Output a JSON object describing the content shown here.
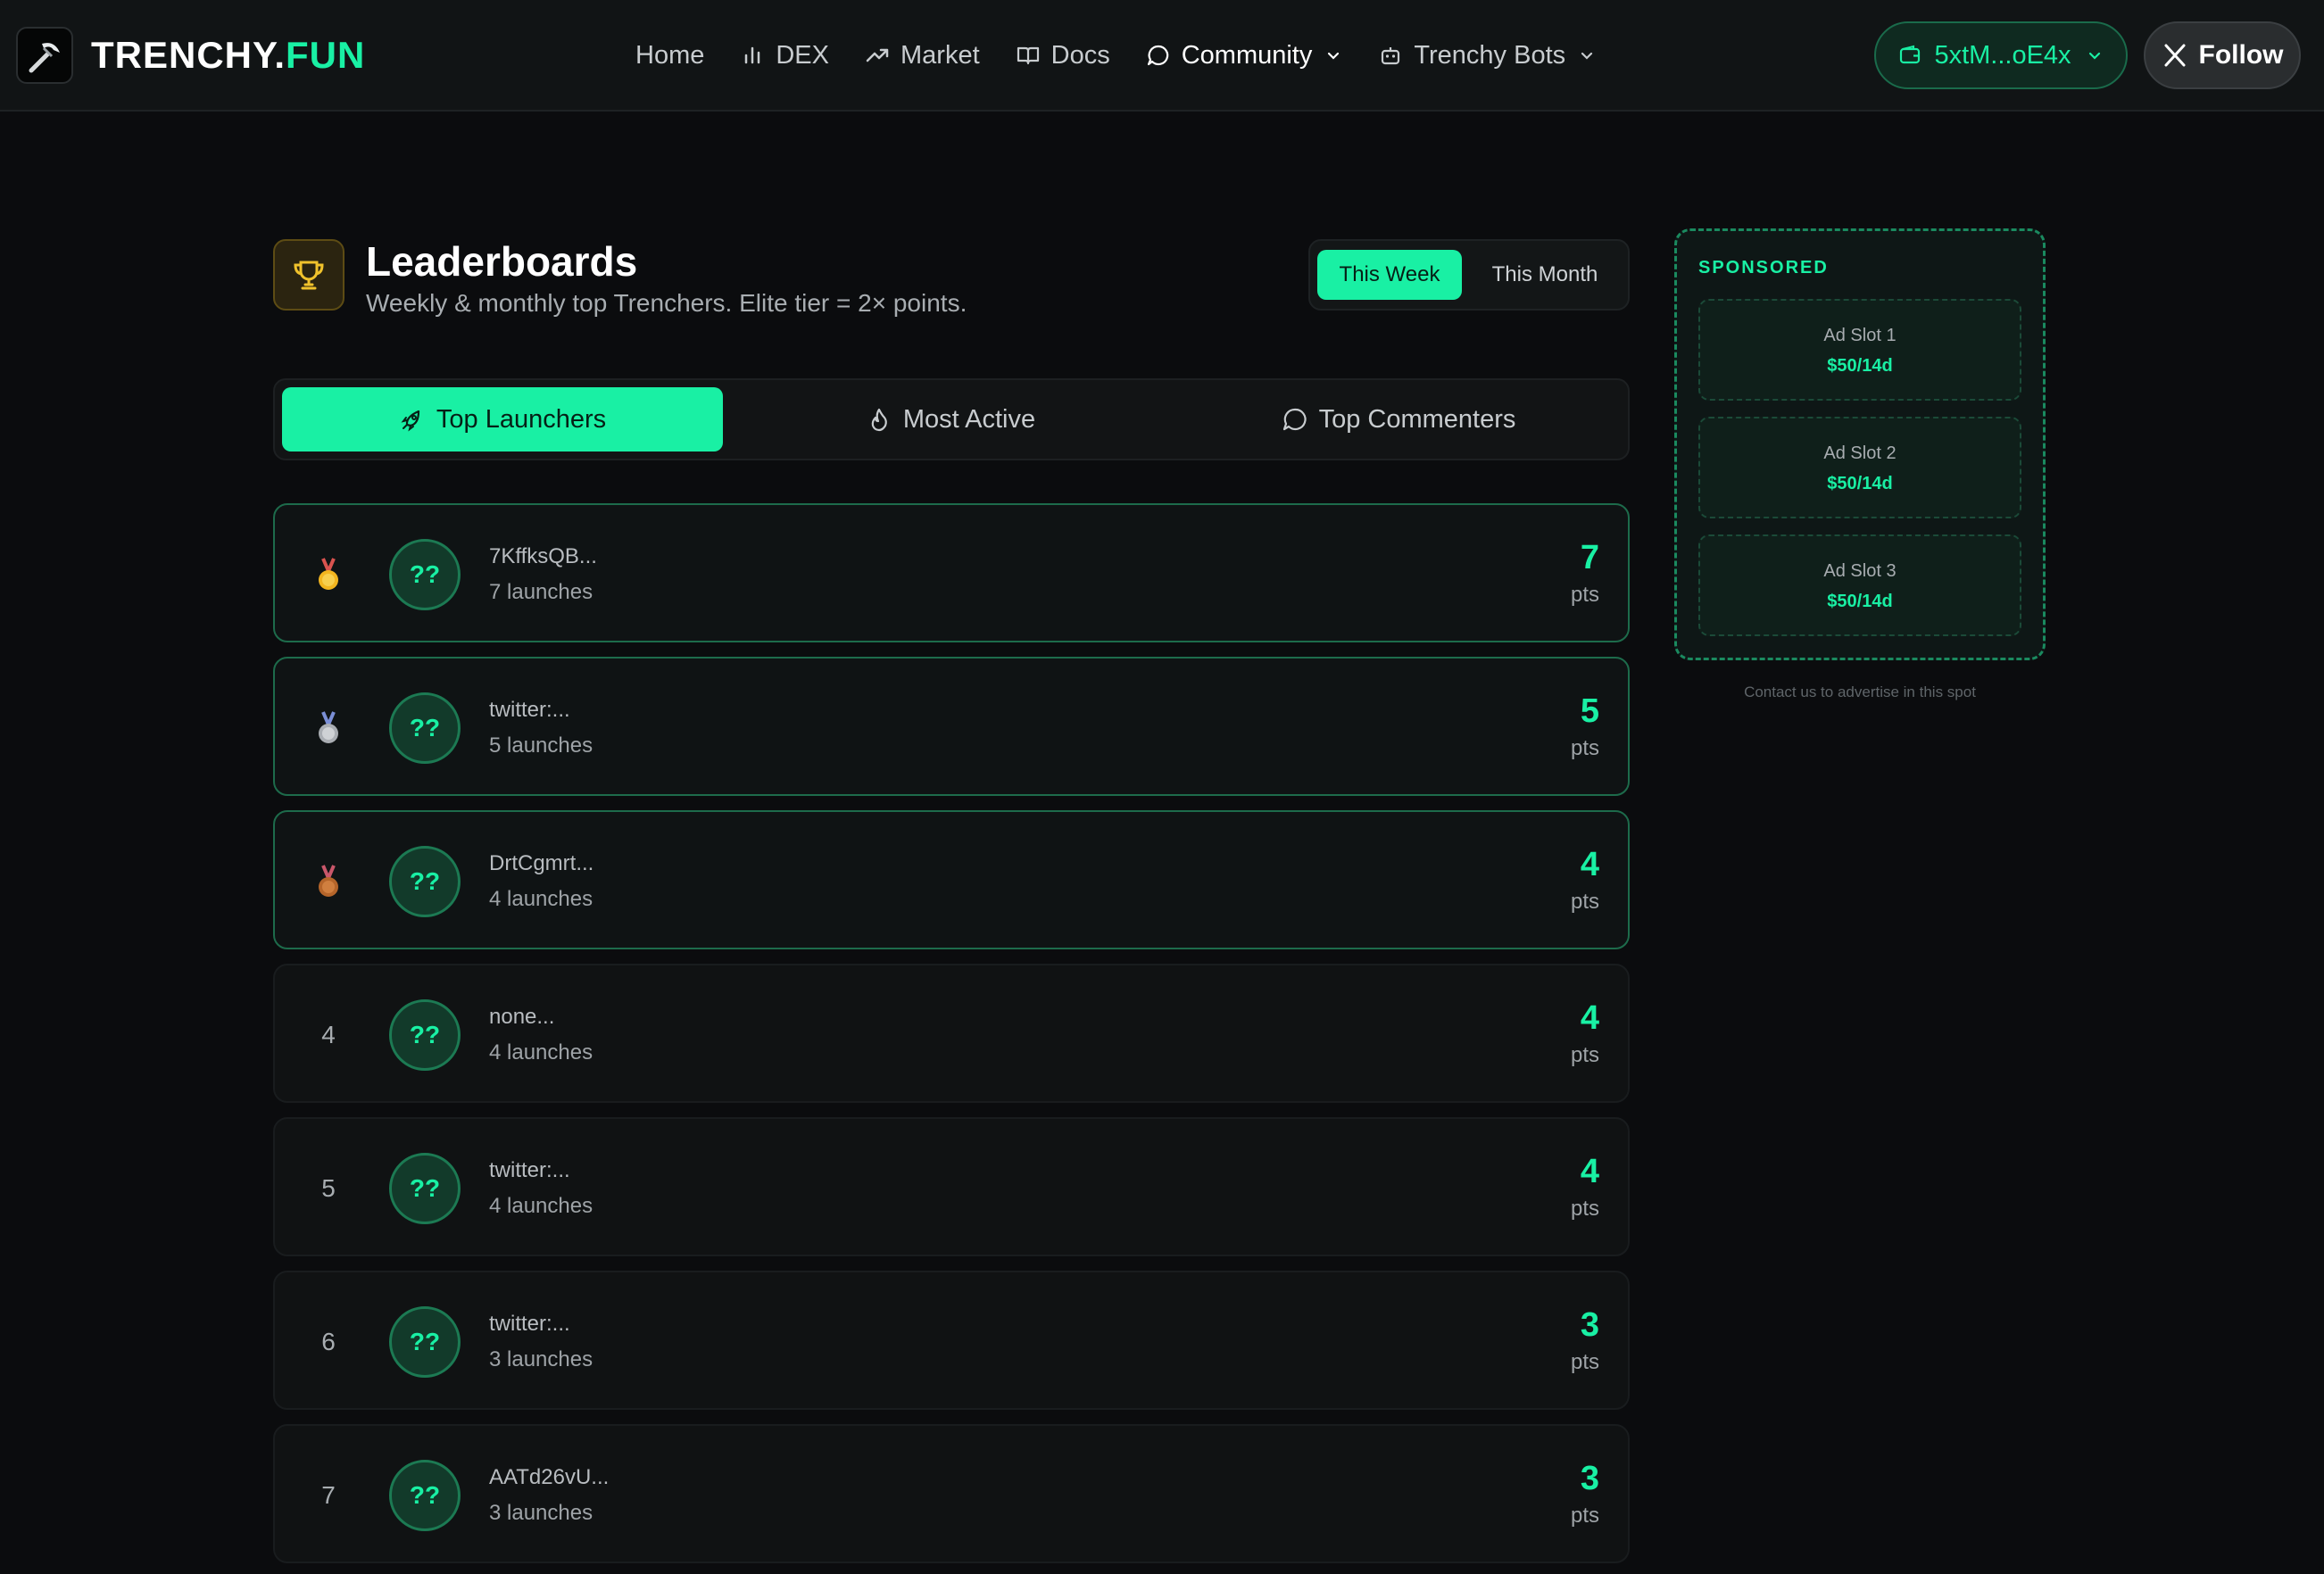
{
  "brand": {
    "name_main": "TRENCHY.",
    "name_accent": "FUN",
    "accent_color": "#19f0a4"
  },
  "nav": {
    "home": "Home",
    "dex": "DEX",
    "market": "Market",
    "docs": "Docs",
    "community": "Community",
    "bots": "Trenchy Bots"
  },
  "wallet": {
    "label": "5xtM...oE4x"
  },
  "follow": {
    "label": "Follow"
  },
  "header": {
    "title": "Leaderboards",
    "subtitle": "Weekly & monthly top Trenchers. Elite tier = 2× points."
  },
  "period": {
    "selected": "This Week",
    "other": "This Month"
  },
  "tabs": {
    "launchers": "Top Launchers",
    "active": "Most Active",
    "commenters": "Top Commenters"
  },
  "rows": [
    {
      "rank": "🥇",
      "avatar": "??",
      "name": "7KffksQB...",
      "count": "7 launches",
      "points": "7",
      "pts": "pts"
    },
    {
      "rank": "🥈",
      "avatar": "??",
      "name": "twitter:...",
      "count": "5 launches",
      "points": "5",
      "pts": "pts"
    },
    {
      "rank": "🥉",
      "avatar": "??",
      "name": "DrtCgmrt...",
      "count": "4 launches",
      "points": "4",
      "pts": "pts"
    },
    {
      "rank": "4",
      "avatar": "??",
      "name": "none...",
      "count": "4 launches",
      "points": "4",
      "pts": "pts"
    },
    {
      "rank": "5",
      "avatar": "??",
      "name": "twitter:...",
      "count": "4 launches",
      "points": "4",
      "pts": "pts"
    },
    {
      "rank": "6",
      "avatar": "??",
      "name": "twitter:...",
      "count": "3 launches",
      "points": "3",
      "pts": "pts"
    },
    {
      "rank": "7",
      "avatar": "??",
      "name": "AATd26vU...",
      "count": "3 launches",
      "points": "3",
      "pts": "pts"
    }
  ],
  "sponsored": {
    "label": "SPONSORED",
    "slots": [
      {
        "name": "Ad Slot 1",
        "price": "$50/14d"
      },
      {
        "name": "Ad Slot 2",
        "price": "$50/14d"
      },
      {
        "name": "Ad Slot 3",
        "price": "$50/14d"
      }
    ],
    "contact": "Contact us to advertise in this spot"
  },
  "icons": {
    "logo": "pickaxe-icon",
    "dex": "bar-chart-icon",
    "market": "trend-up-icon",
    "docs": "book-icon",
    "community": "chat-bubble-icon",
    "bots": "robot-icon",
    "wallet": "wallet-icon",
    "follow": "x-logo-icon",
    "trophy": "trophy-icon",
    "launchers": "rocket-icon",
    "active": "flame-icon",
    "commenters": "comment-icon"
  }
}
